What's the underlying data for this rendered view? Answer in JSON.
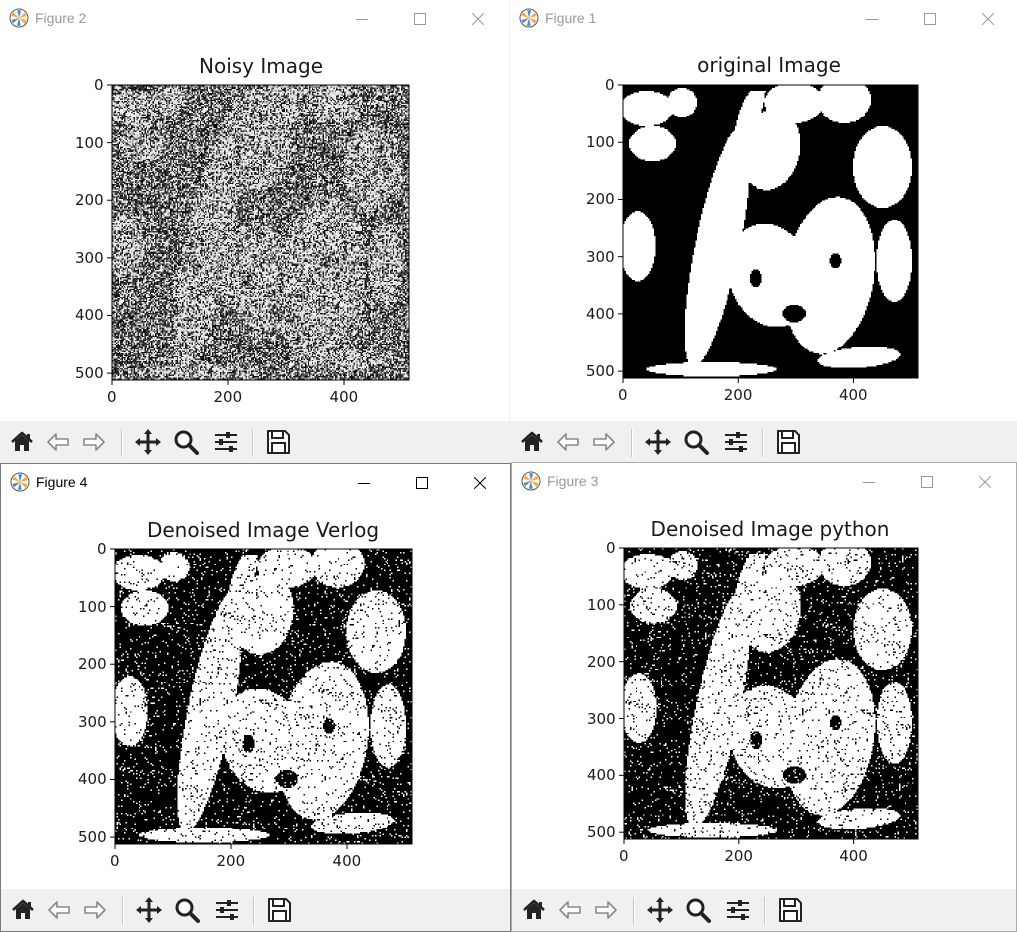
{
  "windows": [
    {
      "id": "fig2",
      "title": "Figure 2",
      "active": false,
      "plot_title": "Noisy Image",
      "image_kind": "noisy"
    },
    {
      "id": "fig1",
      "title": "Figure 1",
      "active": false,
      "plot_title": "original Image",
      "image_kind": "binary"
    },
    {
      "id": "fig4",
      "title": "Figure 4",
      "active": true,
      "plot_title": "Denoised Image Verlog",
      "image_kind": "speckled"
    },
    {
      "id": "fig3",
      "title": "Figure 3",
      "active": false,
      "plot_title": "Denoised Image python",
      "image_kind": "speckled"
    }
  ],
  "axes": {
    "x_ticks": [
      "0",
      "200",
      "400"
    ],
    "y_ticks": [
      "0",
      "100",
      "200",
      "300",
      "400",
      "500"
    ],
    "x_tick_values": [
      0,
      200,
      400
    ],
    "y_tick_values": [
      0,
      100,
      200,
      300,
      400,
      500
    ],
    "xlim": [
      0,
      512
    ],
    "ylim": [
      512,
      0
    ]
  },
  "toolbar": {
    "buttons": [
      {
        "name": "home-icon",
        "tooltip": ""
      },
      {
        "name": "back-arrow-icon",
        "tooltip": ""
      },
      {
        "name": "forward-arrow-icon",
        "tooltip": ""
      },
      {
        "name": "pan-icon",
        "tooltip": ""
      },
      {
        "name": "zoom-icon",
        "tooltip": ""
      },
      {
        "name": "configure-subplots-icon",
        "tooltip": ""
      },
      {
        "name": "save-icon",
        "tooltip": ""
      }
    ]
  },
  "colors": {
    "window_bg": "#ffffff",
    "toolbar_bg": "#f0f0f0",
    "text": "#1a1a1a",
    "inactive_title": "#9a9a9a"
  }
}
